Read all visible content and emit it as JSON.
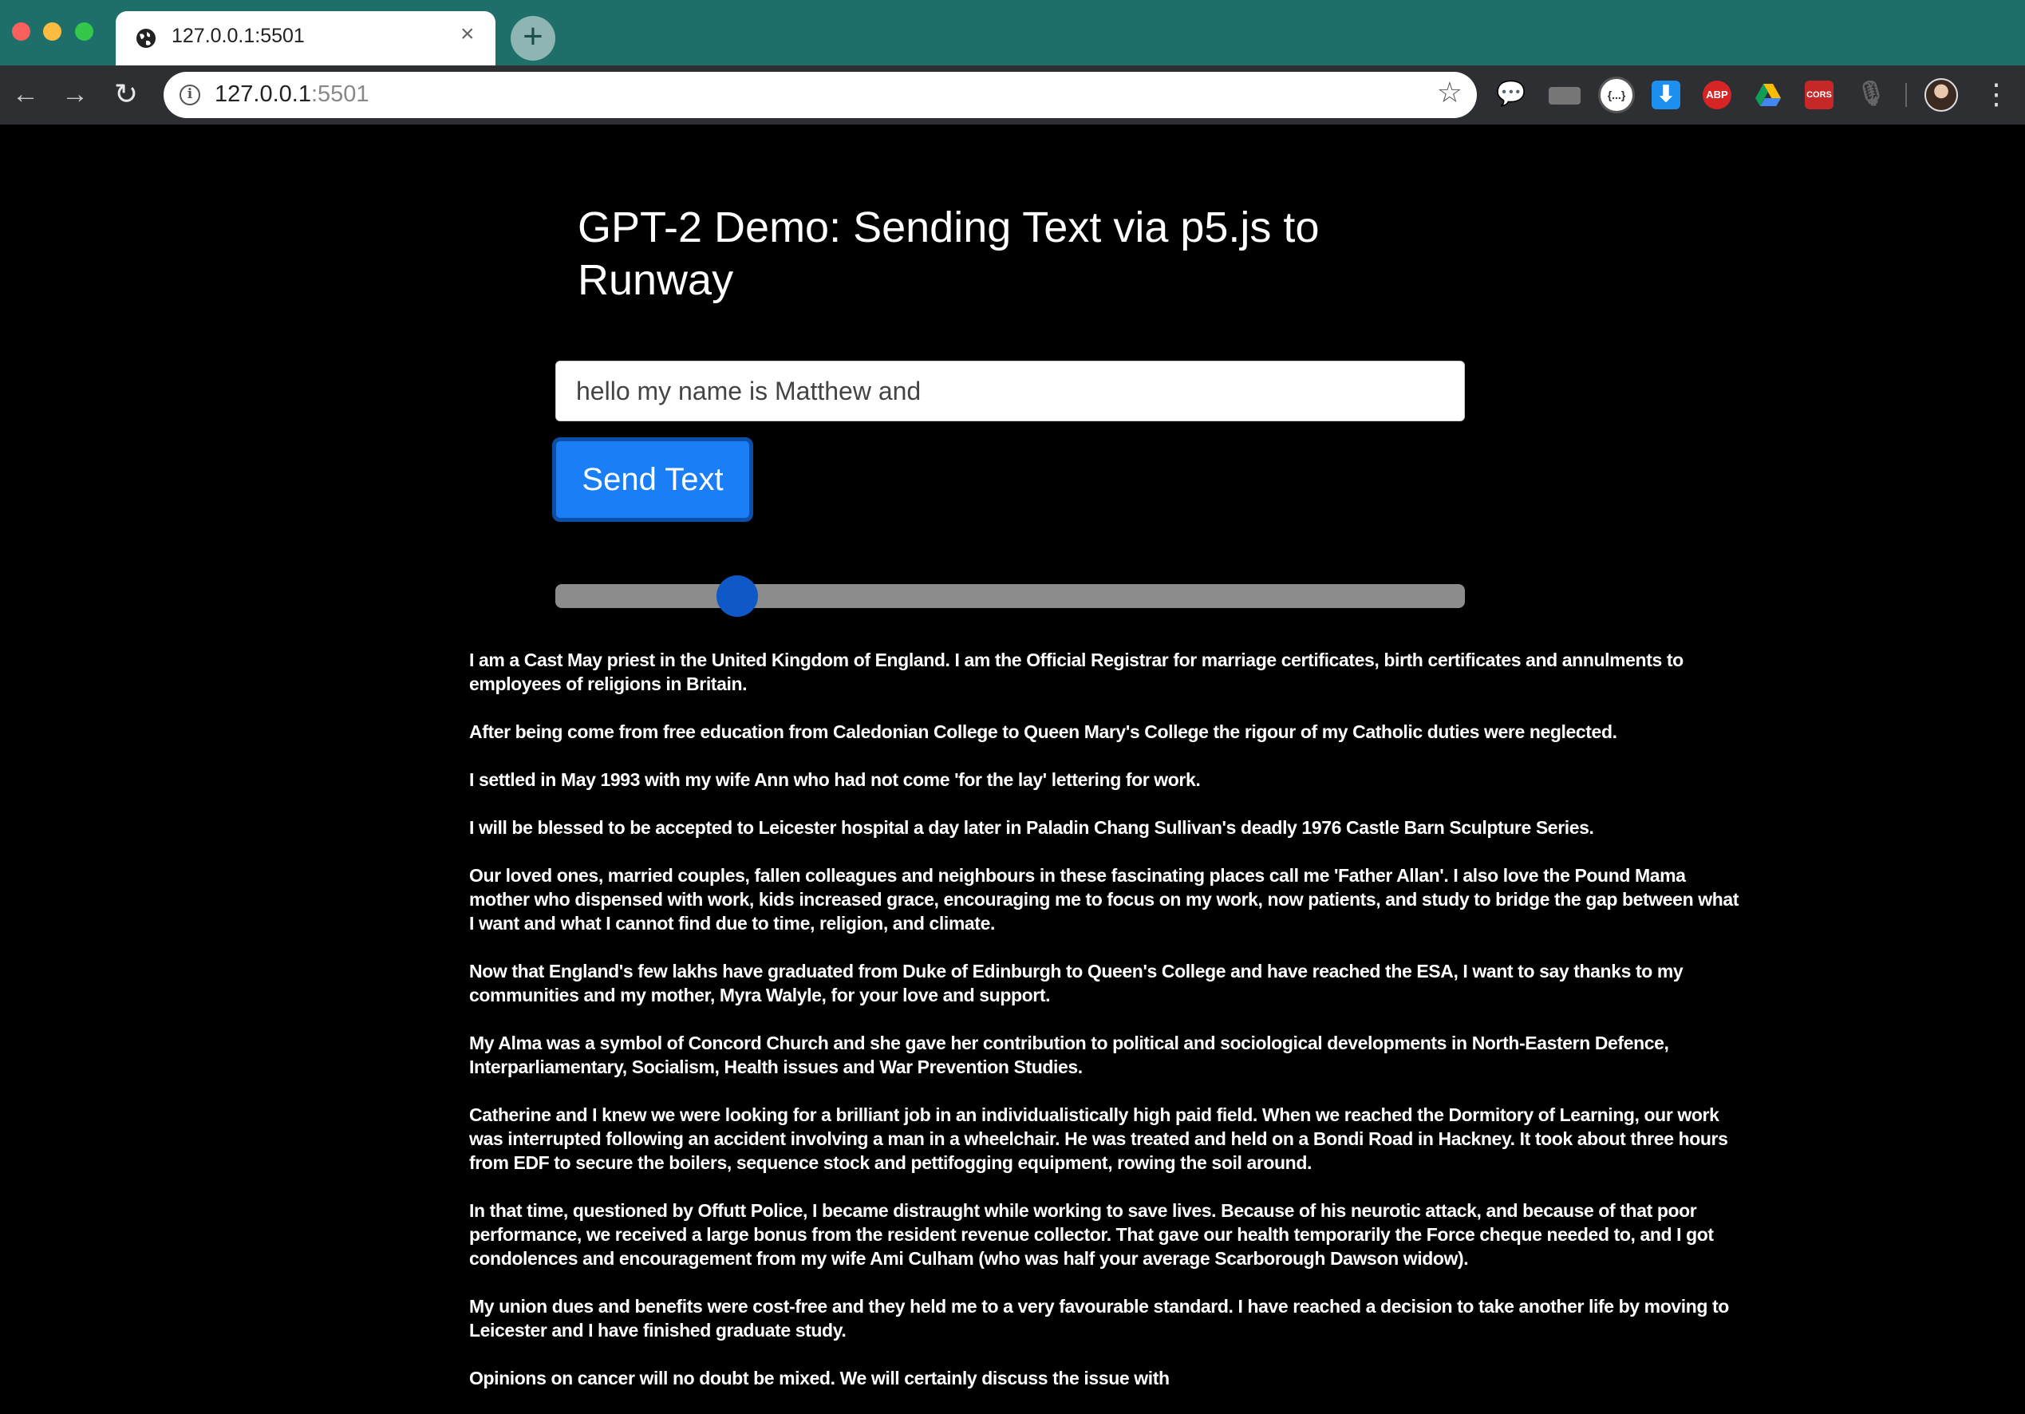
{
  "browser": {
    "tab_title": "127.0.0.1:5501",
    "tab_close": "×",
    "new_tab": "+",
    "url_host": "127.0.0.1",
    "url_port": ":5501",
    "ext_code_label": "{...}",
    "ext_abp_label": "ABP",
    "ext_cors_label": "CORS"
  },
  "page": {
    "title": "GPT-2 Demo: Sending Text via p5.js to Runway",
    "input_value": "hello my name is Matthew and",
    "send_label": "Send Text",
    "slider_value": 0.2
  },
  "output": {
    "paragraphs": [
      " I am a Cast May priest in the United Kingdom of England. I am the Official Registrar for marriage certificates, birth certificates and annulments to employees of religions in Britain.",
      "After being come from free education from Caledonian College to Queen Mary's College the rigour of my Catholic duties were neglected.",
      "I settled in May 1993 with my wife Ann who had not come 'for the lay' lettering for work.",
      "I will be blessed to be accepted to Leicester hospital a day later in Paladin Chang Sullivan's deadly 1976 Castle Barn Sculpture Series.",
      "Our loved ones, married couples, fallen colleagues and neighbours in these fascinating places call me 'Father Allan'. I also love the Pound Mama mother who dispensed with work, kids increased grace, encouraging me to focus on my work, now patients, and study to bridge the gap between what I want and what I cannot find due to time, religion, and climate.",
      "Now that England's few lakhs have graduated from Duke of Edinburgh to Queen's College and have reached the ESA, I want to say thanks to my communities and my mother, Myra Walyle, for your love and support.",
      "My Alma was a symbol of Concord Church and she gave her contribution to political and sociological developments in North-Eastern Defence, Interparliamentary, Socialism, Health issues and War Prevention Studies.",
      "Catherine and I knew we were looking for a brilliant job in an individualistically high paid field. When we reached the Dormitory of Learning, our work was interrupted following an accident involving a man in a wheelchair. He was treated and held on a Bondi Road in Hackney. It took about three hours from EDF to secure the boilers, sequence stock and pettifogging equipment, rowing the soil around.",
      "In that time, questioned by Offutt Police, I became distraught while working to save lives. Because of his neurotic attack, and because of that poor performance, we received a large bonus from the resident revenue collector. That gave our health temporarily the Force cheque needed to, and I got condolences and encouragement from my wife Ami Culham (who was half your average Scarborough Dawson widow).",
      "My union dues and benefits were cost-free and they held me to a very favourable standard. I have reached a decision to take another life by moving to Leicester and I have finished graduate study.",
      "Opinions on cancer will no doubt be mixed. We will certainly discuss the issue with"
    ]
  }
}
